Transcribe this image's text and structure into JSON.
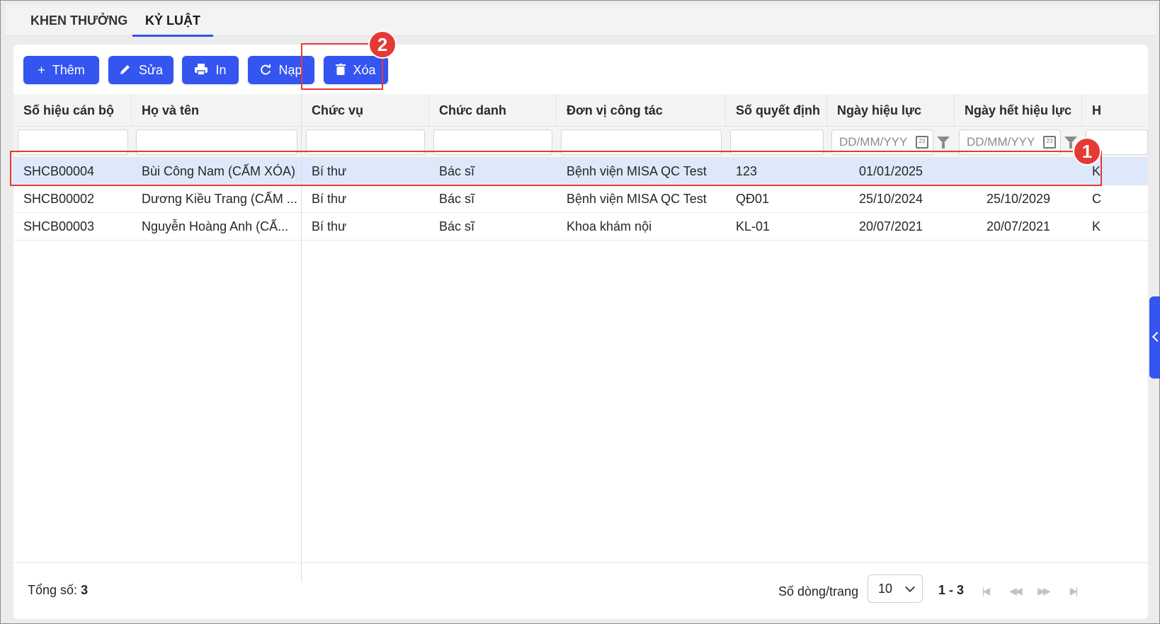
{
  "tabs": [
    {
      "label": "KHEN THƯỞNG",
      "active": false
    },
    {
      "label": "KỶ LUẬT",
      "active": true
    }
  ],
  "toolbar": {
    "add_label": "Thêm",
    "edit_label": "Sửa",
    "print_label": "In",
    "reload_label": "Nạp",
    "delete_label": "Xóa"
  },
  "annotations": {
    "step1": "1",
    "step2": "2"
  },
  "columns": [
    "Số hiệu cán bộ",
    "Họ và tên",
    "Chức vụ",
    "Chức danh",
    "Đơn vị công tác",
    "Số quyết định",
    "Ngày hiệu lực",
    "Ngày hết hiệu lực",
    "H"
  ],
  "filters": {
    "date_placeholder_1": "DD/MM/YYY",
    "date_placeholder_2": "DD/MM/YYY"
  },
  "rows": [
    {
      "ma": "SHCB00004",
      "ten": "Bùi Công Nam (CẤM XÓA)",
      "chucvu": "Bí thư",
      "chucdanh": "Bác sĩ",
      "donvi": "Bệnh viện MISA QC Test",
      "soqd": "123",
      "ngayhl": "01/01/2025",
      "ngayhethl": "",
      "h": "K",
      "selected": true
    },
    {
      "ma": "SHCB00002",
      "ten": "Dương Kiều Trang (CẤM ...",
      "chucvu": "Bí thư",
      "chucdanh": "Bác sĩ",
      "donvi": "Bệnh viện MISA QC Test",
      "soqd": "QĐ01",
      "ngayhl": "25/10/2024",
      "ngayhethl": "25/10/2029",
      "h": "C",
      "selected": false
    },
    {
      "ma": "SHCB00003",
      "ten": "Nguyễn Hoàng Anh (CẤ...",
      "chucvu": "Bí thư",
      "chucdanh": "Bác sĩ",
      "donvi": "Khoa khám nội",
      "soqd": "KL-01",
      "ngayhl": "20/07/2021",
      "ngayhethl": "20/07/2021",
      "h": "K",
      "selected": false
    }
  ],
  "footer": {
    "total_label": "Tổng số:",
    "total_value": "3",
    "perpage_label": "Số dòng/trang",
    "perpage_value": "10",
    "range": "1 - 3"
  },
  "colors": {
    "primary": "#3455f0",
    "selected_row": "#dde9fb",
    "highlight": "#e53935"
  }
}
